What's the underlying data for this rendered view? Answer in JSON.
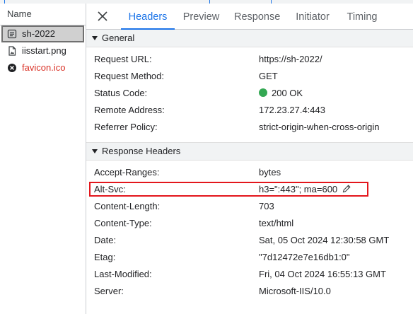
{
  "top_strip": {
    "accent_color": "#1a73e8"
  },
  "sidebar": {
    "header": "Name",
    "requests": [
      {
        "name": "sh-2022",
        "icon": "document-icon",
        "selected": true
      },
      {
        "name": "iisstart.png",
        "icon": "file-icon"
      },
      {
        "name": "favicon.ico",
        "icon": "error-icon",
        "error": true
      }
    ]
  },
  "tabs": [
    "Headers",
    "Preview",
    "Response",
    "Initiator",
    "Timing"
  ],
  "active_tab": "Headers",
  "general": {
    "title": "General",
    "rows": [
      {
        "key": "Request URL:",
        "value": "https://sh-2022/"
      },
      {
        "key": "Request Method:",
        "value": "GET"
      },
      {
        "key": "Status Code:",
        "value": "200 OK"
      },
      {
        "key": "Remote Address:",
        "value": "172.23.27.4:443"
      },
      {
        "key": "Referrer Policy:",
        "value": "strict-origin-when-cross-origin"
      }
    ]
  },
  "response_headers": {
    "title": "Response Headers",
    "rows": [
      {
        "key": "Accept-Ranges:",
        "value": "bytes"
      },
      {
        "key": "Alt-Svc:",
        "value": "h3=\":443\"; ma=600"
      },
      {
        "key": "Content-Length:",
        "value": "703"
      },
      {
        "key": "Content-Type:",
        "value": "text/html"
      },
      {
        "key": "Date:",
        "value": "Sat, 05 Oct 2024 12:30:58 GMT"
      },
      {
        "key": "Etag:",
        "value": "\"7d12472e7e16db1:0\""
      },
      {
        "key": "Last-Modified:",
        "value": "Fri, 04 Oct 2024 16:55:13 GMT"
      },
      {
        "key": "Server:",
        "value": "Microsoft-IIS/10.0"
      }
    ]
  },
  "colors": {
    "active_tab": "#1a73e8",
    "status_ok": "#34a853",
    "error_text": "#d93025",
    "highlight": "#e3161c"
  }
}
